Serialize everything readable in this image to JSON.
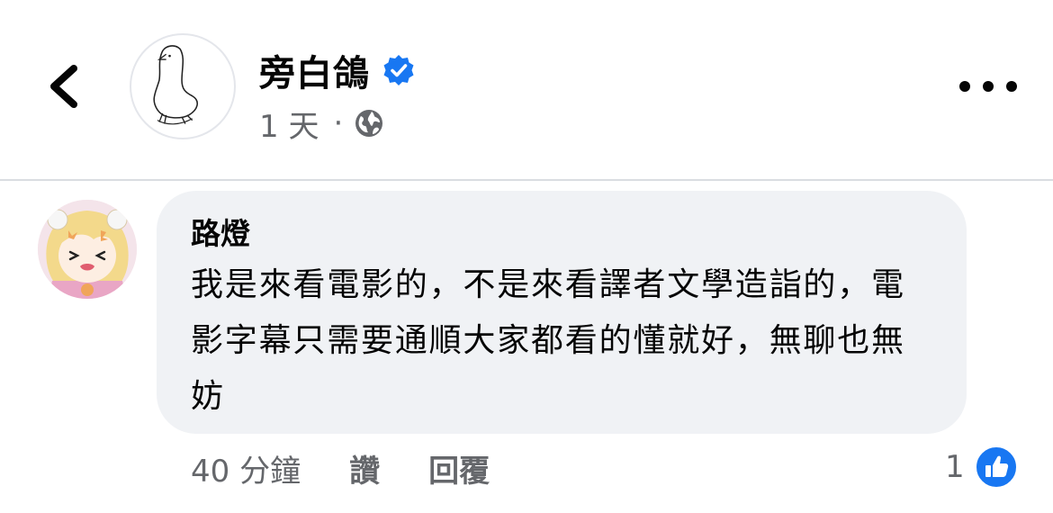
{
  "post": {
    "page_name": "旁白鴿",
    "time": "1 天",
    "separator": "·",
    "privacy_icon": "globe-icon",
    "verified_icon": "verified-badge-icon"
  },
  "comment": {
    "author": "路燈",
    "text": "我是來看電影的，不是來看譯者文學造詣的，電影字幕只需要通順大家都看的懂就好，無聊也無妨",
    "time": "40 分鐘",
    "like_label": "讚",
    "reply_label": "回覆",
    "reaction_count": "1"
  },
  "colors": {
    "verified": "#1877f2",
    "bubble": "#f0f2f5",
    "meta_text": "#65676b"
  }
}
